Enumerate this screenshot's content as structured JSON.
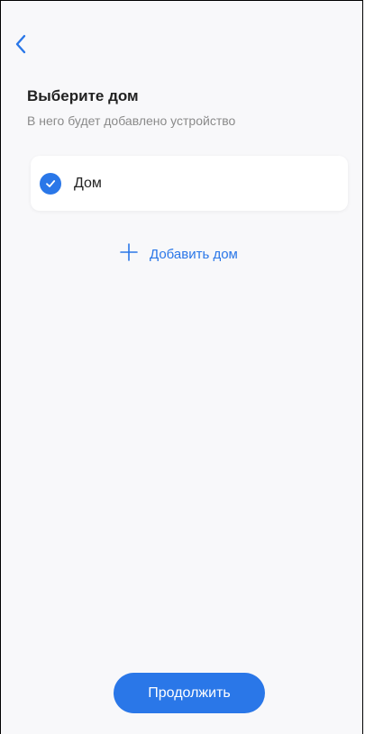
{
  "header": {
    "back_icon": "chevron-left-icon"
  },
  "main": {
    "title": "Выберите дом",
    "subtitle": "В него будет добавлено устройство",
    "homes": [
      {
        "label": "Дом",
        "selected": true
      }
    ],
    "add_home_label": "Добавить дом",
    "add_icon": "plus-icon"
  },
  "footer": {
    "continue_label": "Продолжить"
  },
  "colors": {
    "accent": "#2a77e8",
    "background": "#f8f8fa",
    "card": "#ffffff"
  }
}
